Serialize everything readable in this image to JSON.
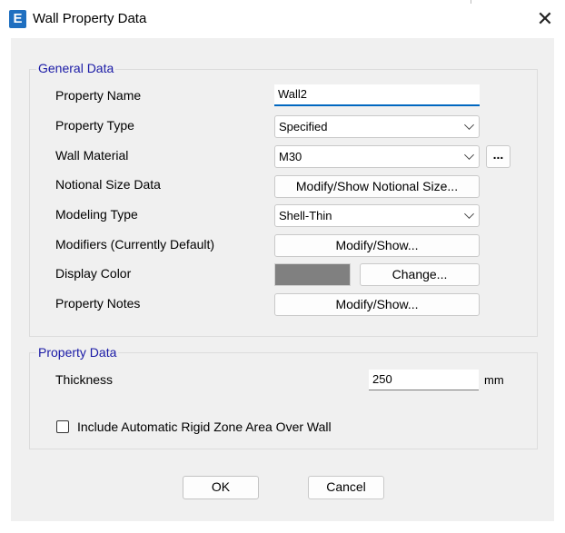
{
  "window": {
    "title": "Wall Property Data",
    "app_icon_letter": "E",
    "close_glyph": "✕"
  },
  "general": {
    "title": "General Data",
    "property_name_label": "Property Name",
    "property_name_value": "Wall2",
    "property_type_label": "Property Type",
    "property_type_value": "Specified",
    "wall_material_label": "Wall Material",
    "wall_material_value": "M30",
    "browse_label": "...",
    "notional_label": "Notional Size Data",
    "notional_button": "Modify/Show Notional Size...",
    "modeling_type_label": "Modeling Type",
    "modeling_type_value": "Shell-Thin",
    "modifiers_label": "Modifiers (Currently Default)",
    "modifiers_button": "Modify/Show...",
    "display_color_label": "Display Color",
    "display_color_value": "#808080",
    "change_button": "Change...",
    "notes_label": "Property Notes",
    "notes_button": "Modify/Show..."
  },
  "property": {
    "title": "Property Data",
    "thickness_label": "Thickness",
    "thickness_value": "250",
    "thickness_unit": "mm",
    "rigid_zone_label": "Include Automatic Rigid Zone Area Over Wall",
    "rigid_zone_checked": false
  },
  "buttons": {
    "ok": "OK",
    "cancel": "Cancel"
  }
}
